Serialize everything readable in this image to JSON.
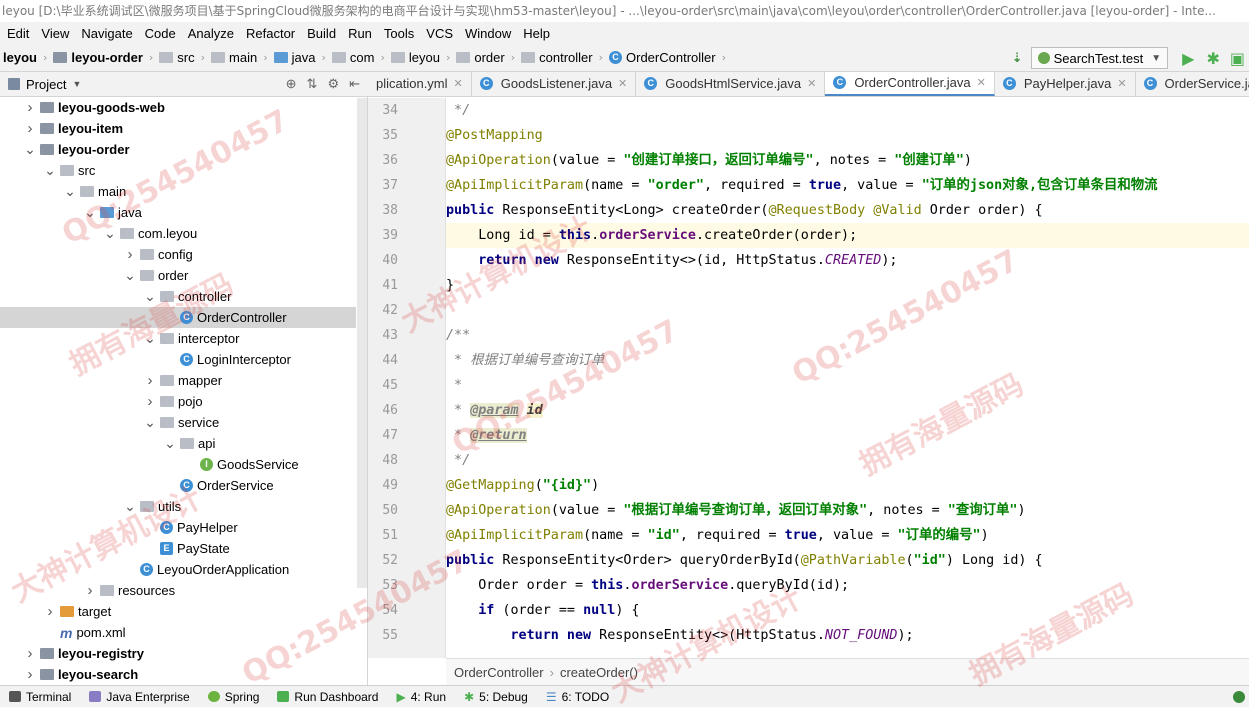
{
  "window": {
    "title": "leyou [D:\\毕业系统调试区\\微服务项目\\基于SpringCloud微服务架构的电商平台设计与实现\\hm53-master\\leyou] - ...\\leyou-order\\src\\main\\java\\com\\leyou\\order\\controller\\OrderController.java [leyou-order] - Inte..."
  },
  "menu": [
    "Edit",
    "View",
    "Navigate",
    "Code",
    "Analyze",
    "Refactor",
    "Build",
    "Run",
    "Tools",
    "VCS",
    "Window",
    "Help"
  ],
  "breadcrumbs": [
    "leyou",
    "leyou-order",
    "src",
    "main",
    "java",
    "com",
    "leyou",
    "order",
    "controller",
    "OrderController"
  ],
  "run_config": "SearchTest.test",
  "project_panel": {
    "title": "Project"
  },
  "tree": [
    {
      "label": "leyou-goods-web",
      "depth": 1,
      "arrow": "right",
      "icon": "module",
      "bold": true
    },
    {
      "label": "leyou-item",
      "depth": 1,
      "arrow": "right",
      "icon": "module",
      "bold": true
    },
    {
      "label": "leyou-order",
      "depth": 1,
      "arrow": "down",
      "icon": "module",
      "bold": true
    },
    {
      "label": "src",
      "depth": 2,
      "arrow": "down",
      "icon": "folder"
    },
    {
      "label": "main",
      "depth": 3,
      "arrow": "down",
      "icon": "folder"
    },
    {
      "label": "java",
      "depth": 4,
      "arrow": "down",
      "icon": "source-folder"
    },
    {
      "label": "com.leyou",
      "depth": 5,
      "arrow": "down",
      "icon": "package"
    },
    {
      "label": "config",
      "depth": 6,
      "arrow": "right",
      "icon": "package"
    },
    {
      "label": "order",
      "depth": 6,
      "arrow": "down",
      "icon": "package"
    },
    {
      "label": "controller",
      "depth": 7,
      "arrow": "down",
      "icon": "package"
    },
    {
      "label": "OrderController",
      "depth": 8,
      "arrow": "none",
      "icon": "class",
      "selected": true
    },
    {
      "label": "interceptor",
      "depth": 7,
      "arrow": "down",
      "icon": "package"
    },
    {
      "label": "LoginInterceptor",
      "depth": 8,
      "arrow": "none",
      "icon": "class"
    },
    {
      "label": "mapper",
      "depth": 7,
      "arrow": "right",
      "icon": "package"
    },
    {
      "label": "pojo",
      "depth": 7,
      "arrow": "right",
      "icon": "package"
    },
    {
      "label": "service",
      "depth": 7,
      "arrow": "down",
      "icon": "package"
    },
    {
      "label": "api",
      "depth": 8,
      "arrow": "down",
      "icon": "package"
    },
    {
      "label": "GoodsService",
      "depth": 9,
      "arrow": "none",
      "icon": "interface"
    },
    {
      "label": "OrderService",
      "depth": 8,
      "arrow": "none",
      "icon": "class"
    },
    {
      "label": "utils",
      "depth": 6,
      "arrow": "down",
      "icon": "package"
    },
    {
      "label": "PayHelper",
      "depth": 7,
      "arrow": "none",
      "icon": "class"
    },
    {
      "label": "PayState",
      "depth": 7,
      "arrow": "none",
      "icon": "enum"
    },
    {
      "label": "LeyouOrderApplication",
      "depth": 6,
      "arrow": "none",
      "icon": "class"
    },
    {
      "label": "resources",
      "depth": 4,
      "arrow": "right",
      "icon": "folder"
    },
    {
      "label": "target",
      "depth": 2,
      "arrow": "right",
      "icon": "orange-folder"
    },
    {
      "label": "pom.xml",
      "depth": 2,
      "arrow": "none",
      "icon": "maven"
    },
    {
      "label": "leyou-registry",
      "depth": 1,
      "arrow": "right",
      "icon": "module",
      "bold": true
    },
    {
      "label": "leyou-search",
      "depth": 1,
      "arrow": "right",
      "icon": "module",
      "bold": true
    }
  ],
  "tabs": [
    {
      "label": "plication.yml",
      "icon": "yml",
      "active": false
    },
    {
      "label": "GoodsListener.java",
      "icon": "class",
      "active": false
    },
    {
      "label": "GoodsHtmlService.java",
      "icon": "class",
      "active": false
    },
    {
      "label": "OrderController.java",
      "icon": "class",
      "active": true
    },
    {
      "label": "PayHelper.java",
      "icon": "class",
      "active": false
    },
    {
      "label": "OrderService.ja",
      "icon": "class",
      "active": false
    }
  ],
  "code": {
    "line_numbers": [
      "34",
      "35",
      "36",
      "37",
      "38",
      "39",
      "40",
      "41",
      "42",
      "43",
      "44",
      "45",
      "46",
      "47",
      "48",
      "49",
      "50",
      "51",
      "52",
      "53",
      "54",
      "55"
    ],
    "current_line": "39"
  },
  "editor_breadcrumb": [
    "OrderController",
    "createOrder()"
  ],
  "status_bar": [
    "Terminal",
    "Java Enterprise",
    "Spring",
    "Run Dashboard",
    "4: Run",
    "5: Debug",
    "6: TODO"
  ],
  "watermarks": [
    "QQ:254540457",
    "大神计算机设计",
    "拥有海量源码",
    "QQ:254540457",
    "拥有海量源码",
    "大神计算机设计",
    "QQ:254540457",
    "拥有海量源码",
    "QQ:254540457",
    "大神计算机设计"
  ]
}
